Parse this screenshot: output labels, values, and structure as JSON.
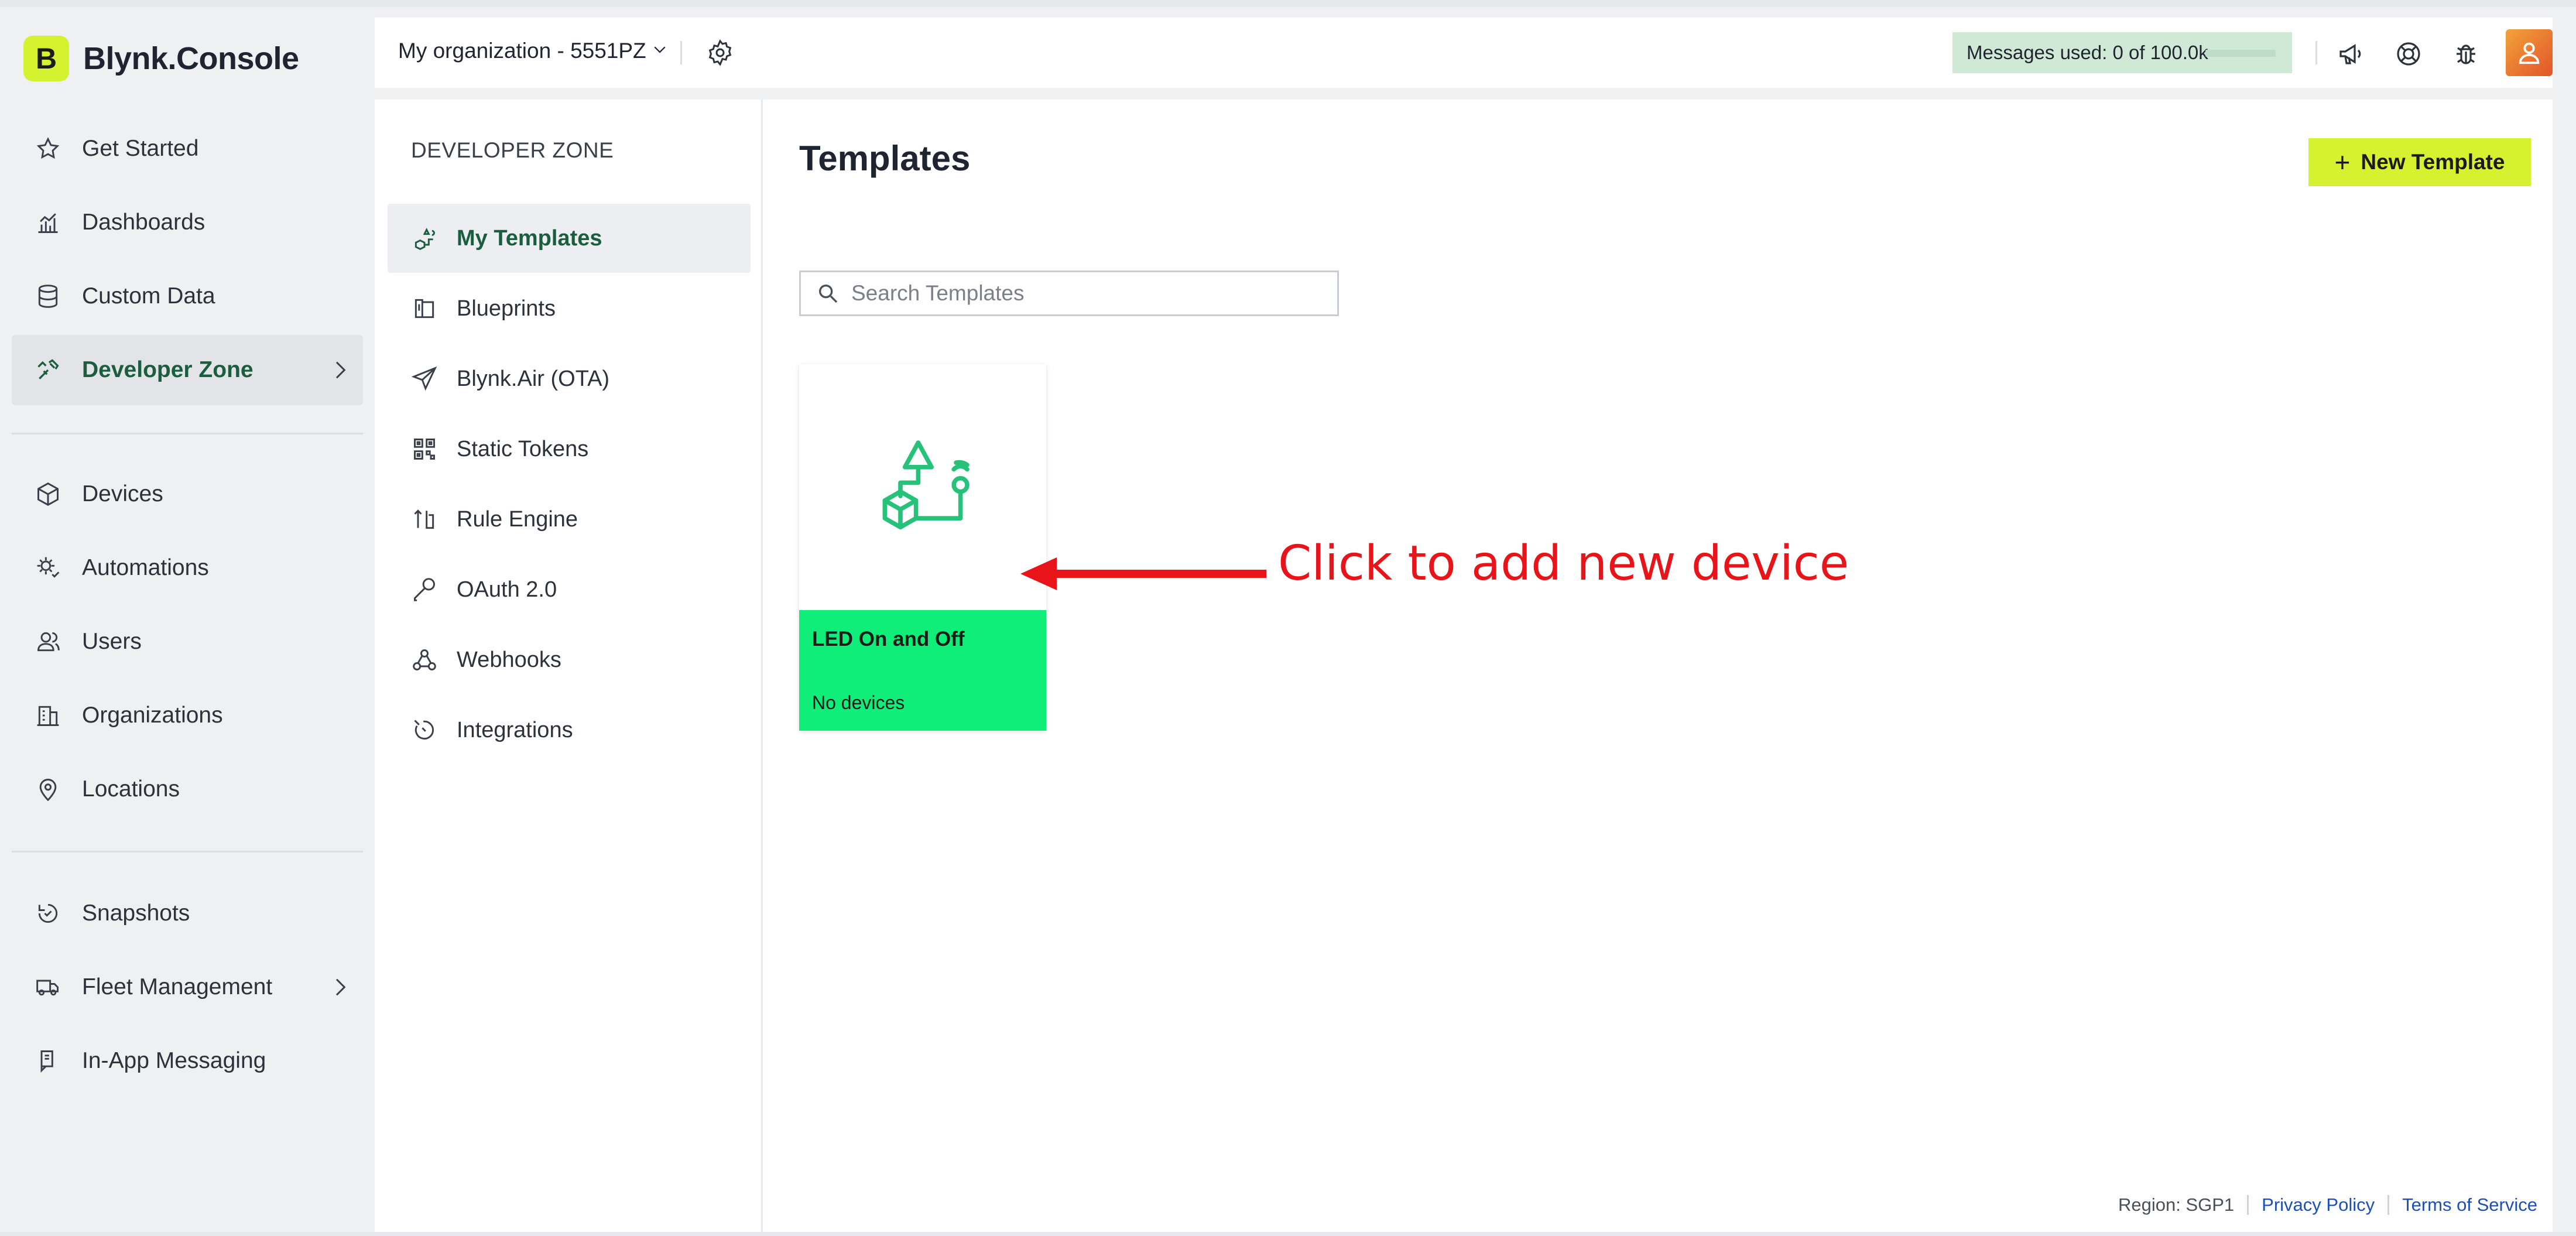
{
  "brand": {
    "logo_letter": "B",
    "name": "Blynk.Console",
    "accent": "#d4f230"
  },
  "sidebar": {
    "items": [
      {
        "label": "Get Started",
        "icon": "star-icon"
      },
      {
        "label": "Dashboards",
        "icon": "chart-icon"
      },
      {
        "label": "Custom Data",
        "icon": "database-icon"
      },
      {
        "label": "Developer Zone",
        "icon": "tools-icon",
        "active": true,
        "has_chevron": true
      },
      {
        "label": "Devices",
        "icon": "cube-icon"
      },
      {
        "label": "Automations",
        "icon": "automation-icon"
      },
      {
        "label": "Users",
        "icon": "users-icon"
      },
      {
        "label": "Organizations",
        "icon": "building-icon"
      },
      {
        "label": "Locations",
        "icon": "location-pin-icon"
      },
      {
        "label": "Snapshots",
        "icon": "snapshot-icon"
      },
      {
        "label": "Fleet Management",
        "icon": "truck-icon",
        "has_chevron": true
      },
      {
        "label": "In-App Messaging",
        "icon": "message-icon"
      }
    ]
  },
  "header": {
    "org_name": "My organization - 5551PZ",
    "messages_used": "Messages used: 0 of 100.0k",
    "icons": [
      "announcement-icon",
      "help-lifebuoy-icon",
      "bug-icon",
      "user-avatar-icon"
    ]
  },
  "dev_zone": {
    "title": "DEVELOPER ZONE",
    "items": [
      {
        "label": "My Templates",
        "icon": "templates-icon",
        "active": true
      },
      {
        "label": "Blueprints",
        "icon": "blueprint-icon"
      },
      {
        "label": "Blynk.Air (OTA)",
        "icon": "paper-plane-icon"
      },
      {
        "label": "Static Tokens",
        "icon": "qr-code-icon"
      },
      {
        "label": "Rule Engine",
        "icon": "rule-engine-icon"
      },
      {
        "label": "OAuth 2.0",
        "icon": "key-icon"
      },
      {
        "label": "Webhooks",
        "icon": "webhook-icon"
      },
      {
        "label": "Integrations",
        "icon": "integrations-icon"
      }
    ]
  },
  "main": {
    "title": "Templates",
    "new_button": "New Template",
    "search_placeholder": "Search Templates",
    "templates": [
      {
        "name": "LED On and Off",
        "devices": "No devices",
        "card_color": "#10ee7a"
      }
    ]
  },
  "annotation": {
    "text": "Click to add new device",
    "color": "#e8141a"
  },
  "footer": {
    "region": "Region: SGP1",
    "privacy": "Privacy Policy",
    "terms": "Terms of Service"
  }
}
